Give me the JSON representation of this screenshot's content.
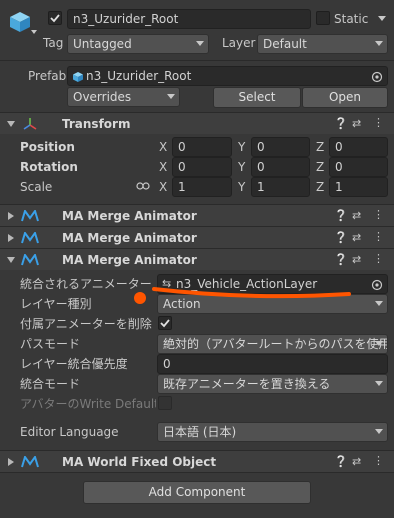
{
  "object": {
    "name": "n3_Uzurider_Root",
    "active_checked": true,
    "static_label": "Static",
    "tag_label": "Tag",
    "tag_value": "Untagged",
    "layer_label": "Layer",
    "layer_value": "Default",
    "prefab_label": "Prefab",
    "prefab_value": "n3_Uzurider_Root",
    "overrides_label": "Overrides",
    "select_label": "Select",
    "open_label": "Open"
  },
  "transform": {
    "title": "Transform",
    "position_label": "Position",
    "rotation_label": "Rotation",
    "scale_label": "Scale",
    "axis_x": "X",
    "axis_y": "Y",
    "axis_z": "Z",
    "position": [
      "0",
      "0",
      "0"
    ],
    "rotation": [
      "0",
      "0",
      "0"
    ],
    "scale": [
      "1",
      "1",
      "1"
    ]
  },
  "components": {
    "merge1_title": "MA Merge Animator",
    "merge2_title": "MA Merge Animator",
    "merge3_title": "MA Merge Animator",
    "world_fixed_title": "MA World Fixed Object"
  },
  "merge_animator": {
    "animator_label": "統合されるアニメーター",
    "animator_value": "n3_Vehicle_ActionLayer",
    "layer_type_label": "レイヤー種別",
    "layer_type_value": "Action",
    "delete_attached_label": "付属アニメーターを削除",
    "delete_attached_checked": true,
    "path_mode_label": "パスモード",
    "path_mode_value": "絶対的（アバタールートからのパスを使用）",
    "layer_priority_label": "レイヤー統合優先度",
    "layer_priority_value": "0",
    "merge_mode_label": "統合モード",
    "merge_mode_value": "既存アニメーターを置き換える",
    "write_defaults_label": "アバターのWrite Defaults設",
    "editor_language_label": "Editor Language",
    "editor_language_value": "日本語 (日本)"
  },
  "footer": {
    "add_component_label": "Add Component"
  },
  "colors": {
    "annotation": "#ff5500",
    "ma_logo": "#3aa0e8"
  }
}
